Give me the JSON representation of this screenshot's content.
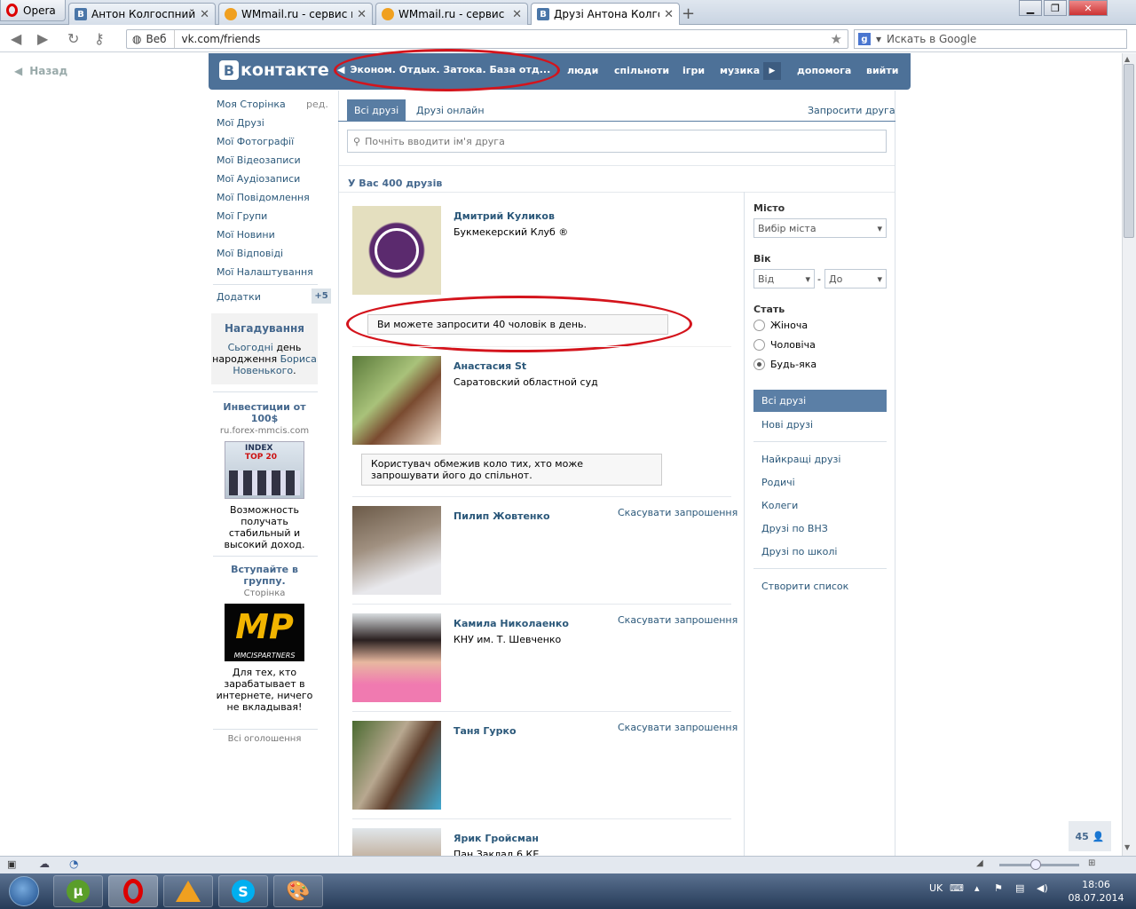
{
  "browser": {
    "menu_label": "Opera",
    "tabs": [
      {
        "title": "Антон Колгоспний",
        "favicon": "vk-icon"
      },
      {
        "title": "WMmail.ru - сервис п...",
        "favicon": "wmmail-icon"
      },
      {
        "title": "WMmail.ru - сервис п...",
        "favicon": "wmmail-icon"
      },
      {
        "title": "Друзі Антона Колгосп...",
        "favicon": "vk-icon"
      }
    ],
    "web_label": "Веб",
    "url": "vk.com/friends",
    "search_placeholder": "Искать в Google"
  },
  "page": {
    "back_label": "Назад",
    "logo_text": "контакте",
    "logo_letter": "В",
    "player_text": "Эконом. Отдых. Затока. База отд...",
    "topnav": [
      "люди",
      "спільноти",
      "ігри",
      "музика",
      "допомога",
      "вийти"
    ]
  },
  "left_menu": {
    "items": [
      "Моя Сторінка",
      "Мої Друзі",
      "Мої Фотографії",
      "Мої Відеозаписи",
      "Мої Аудіозаписи",
      "Мої Повідомлення",
      "Мої Групи",
      "Мої Новини",
      "Мої Відповіді",
      "Мої Налаштування"
    ],
    "edit_label": "ред.",
    "apps_label": "Додатки",
    "apps_badge": "+5",
    "reminder": {
      "title": "Нагадування",
      "today": "Сьогодні",
      "text1": " день народження ",
      "person": "Бориса Новенького",
      "dot": "."
    },
    "ads": [
      {
        "title": "Инвестиции от 100$",
        "source": "ru.forex-mmcis.com",
        "image_text1": "INDEX",
        "image_text2": "TOP 20",
        "desc": "Возможность получать стабильный и высокий доход."
      },
      {
        "title": "Вступайте в группу.",
        "source": "Сторінка",
        "image_text1": "MP",
        "image_text2": "MMCISPARTNERS",
        "desc": "Для тех, кто зарабатывает в интернете, ничего не вкладывая!"
      }
    ],
    "all_ads": "Всі оголошення"
  },
  "friends": {
    "tabs": [
      "Всі друзі",
      "Друзі онлайн"
    ],
    "invite": "Запросити друга",
    "search_placeholder": "Почніть вводити ім'я друга",
    "count_text": "У Вас 400 друзів",
    "notice1": "Ви можете запросити 40 чоловік в день.",
    "notice2": "Користувач обмежив коло тих, хто може запрошувати його до спільнот.",
    "cancel_label": "Скасувати запрошення",
    "list": [
      {
        "name": "Дмитрий Куликов",
        "sub": "Букмекерский Клуб ®"
      },
      {
        "name": "Анастасия St",
        "sub": "Саратовский областной суд"
      },
      {
        "name": "Пилип Жовтенко",
        "sub": ""
      },
      {
        "name": "Камила Николаенко",
        "sub": "КНУ им. Т. Шевченко"
      },
      {
        "name": "Таня Гурко",
        "sub": ""
      },
      {
        "name": "Ярик Гройсман",
        "sub": "Пан Заклад 6 КЕ..."
      }
    ]
  },
  "filters": {
    "city_label": "Місто",
    "city_select": "Вибір міста",
    "age_label": "Вік",
    "age_from": "Від",
    "age_dash": "-",
    "age_to": "До",
    "sex_label": "Стать",
    "sex_options": [
      "Жіноча",
      "Чоловіча",
      "Будь-яка"
    ],
    "sex_selected": "Будь-яка",
    "list1": [
      "Всі друзі",
      "Нові друзі"
    ],
    "list2": [
      "Найкращі друзі",
      "Родичі",
      "Колеги",
      "Друзі по ВНЗ",
      "Друзі по школі"
    ],
    "create_list": "Створити список",
    "online_count": "45"
  },
  "taskbar": {
    "lang": "UK",
    "time": "18:06",
    "date": "08.07.2014"
  },
  "colors": {
    "vk_header": "#4d7198",
    "link": "#2b587a",
    "annotation_red": "#d4141c"
  }
}
